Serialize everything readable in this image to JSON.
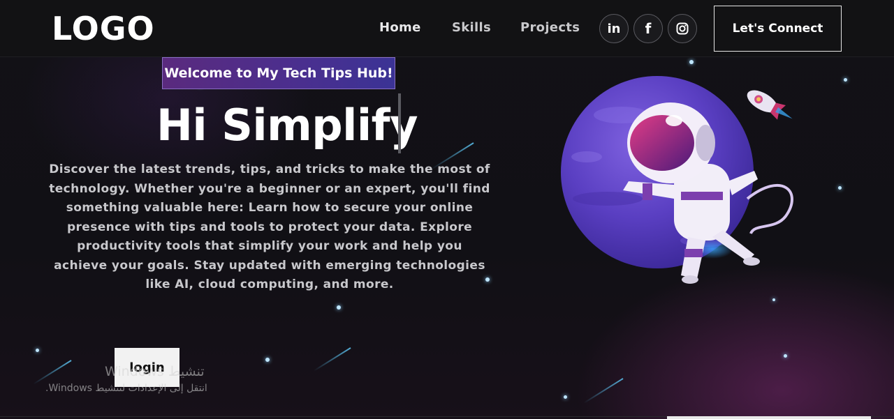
{
  "header": {
    "logo": "LOGO",
    "nav": [
      {
        "label": "Home"
      },
      {
        "label": "Skills"
      },
      {
        "label": "Projects"
      }
    ],
    "socials": [
      {
        "icon": "linkedin-icon",
        "glyph": "in"
      },
      {
        "icon": "facebook-icon",
        "glyph": "f"
      },
      {
        "icon": "instagram-icon",
        "glyph": ""
      }
    ],
    "connect_label": "Let's Connect"
  },
  "hero": {
    "tagline": "Welcome to My Tech Tips Hub!",
    "headline": "Hi Simplify",
    "description": "Discover the latest trends, tips, and tricks to make the most of technology. Whether you're a beginner or an expert, you'll find something valuable here: Learn how to secure your online presence with tips and tools to protect your data. Explore productivity tools that simplify your work and help you achieve your goals. Stay updated with emerging technologies like AI, cloud computing, and more.",
    "login_label": "login"
  },
  "windows_activation": {
    "title": "تنشيط Windows",
    "subtitle": "انتقل إلى الإعدادات لتنشيط Windows."
  },
  "colors": {
    "background": "#121214",
    "tagline_gradient_start": "#5a2a7e",
    "tagline_gradient_end": "#3b3395",
    "planet": "#6a4fd0",
    "text_muted": "#c8c8cc"
  }
}
